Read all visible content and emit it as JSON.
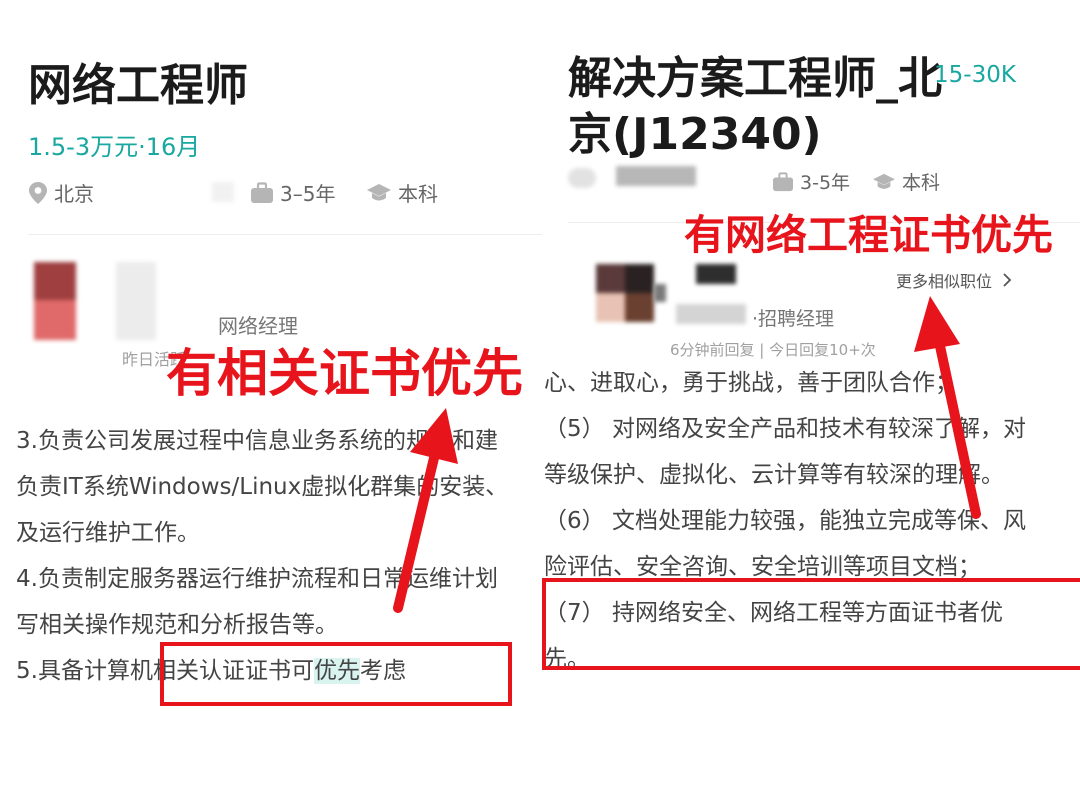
{
  "left": {
    "title": "网络工程师",
    "salary": "1.5-3万元·16月",
    "location": "北京",
    "experience": "3–5年",
    "education": "本科",
    "recruiter_title": "网络经理",
    "active_status": "昨日活跃",
    "callout": "有相关证书优先",
    "description_lines": [
      "3.负责公司发展过程中信息业务系统的规划和建",
      "负责IT系统Windows/Linux虚拟化群集的安装、",
      "及运行维护工作。",
      "4.负责制定服务器运行维护流程和日常运维计划",
      "写相关操作规范和分析报告等。"
    ],
    "last_line": {
      "before": "5.具备计算机相关认证证书可",
      "highlight": "优先",
      "after": "考虑"
    }
  },
  "right": {
    "title_line1": "解决方案工程师_北",
    "title_line2": "京(J12340)",
    "salary": "15-30K",
    "experience": "3-5年",
    "education": "本科",
    "callout": "有网络工程证书优先",
    "more_similar": "更多相似职位",
    "recruiter_title": "·招聘经理",
    "reply_info": "6分钟前回复 | 今日回复10+次",
    "description_lines": [
      "心、进取心，勇于挑战，善于团队合作；",
      "（5） 对网络及安全产品和技术有较深了解，对",
      "等级保护、虚拟化、云计算等有较深的理解。",
      "（6） 文档处理能力较强，能独立完成等保、风",
      "险评估、安全咨询、安全培训等项目文档；",
      "（7） 持网络安全、网络工程等方面证书者优",
      "先。"
    ]
  },
  "colors": {
    "accent": "#18a8a0",
    "annotation_red": "#e8141c"
  },
  "icons": [
    "location-pin-icon",
    "briefcase-icon",
    "graduation-cap-icon",
    "chevron-right-icon"
  ]
}
